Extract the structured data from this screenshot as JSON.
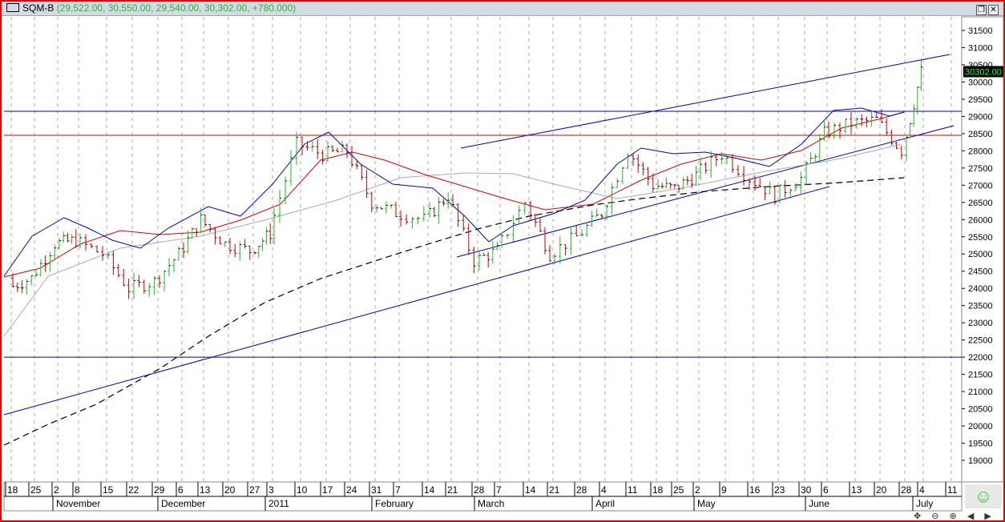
{
  "header": {
    "symbol": "SQM-B",
    "values": "(29,522.00, 30,550.00, 29,540.00, 30,302.00, +780.000)"
  },
  "chart_data": {
    "type": "ohlc",
    "title": "SQM-B",
    "last_price_label": "30302.00",
    "ylim": [
      18500,
      31800
    ],
    "y_ticks": [
      31500,
      31000,
      30500,
      30000,
      29500,
      29000,
      28500,
      28000,
      27500,
      27000,
      26500,
      26000,
      25500,
      25000,
      24500,
      24000,
      23500,
      23000,
      22500,
      22000,
      21500,
      21000,
      20500,
      20000,
      19500,
      19000
    ],
    "x_day_labels": [
      "18",
      "25",
      "2",
      "8",
      "15",
      "22",
      "29",
      "6",
      "13",
      "20",
      "27",
      "3",
      "10",
      "17",
      "24",
      "31",
      "7",
      "14",
      "21",
      "28",
      "7",
      "14",
      "21",
      "28",
      "4",
      "11",
      "18",
      "25",
      "2",
      "9",
      "16",
      "23",
      "30",
      "6",
      "13",
      "20",
      "28",
      "4",
      "11"
    ],
    "x_month_labels": [
      "November",
      "December",
      "2011",
      "February",
      "March",
      "April",
      "May",
      "June",
      "July"
    ],
    "weekly_closes": [
      24300,
      25300,
      25400,
      25000,
      24000,
      24200,
      25000,
      26000,
      25300,
      25100,
      25600,
      28200,
      27900,
      28000,
      26500,
      26200,
      26000,
      26700,
      24800,
      25100,
      26500,
      25000,
      25500,
      26200,
      28000,
      27000,
      26900,
      27300,
      27900,
      27200,
      26700,
      27200,
      28500,
      28800,
      28900,
      28000,
      30302
    ],
    "horizontal_lines": [
      {
        "price": 29150,
        "color": "#0000c0"
      },
      {
        "price": 28450,
        "color": "#d00000"
      },
      {
        "price": 22000,
        "color": "#0000c0"
      }
    ],
    "colors": {
      "up": "#22bb22",
      "down": "#cc0000",
      "ma_short": "#0000cc",
      "ma_mid": "#dd0000",
      "ma_long": "#aaaaaa",
      "ma_200": "#000000"
    }
  },
  "footer": {
    "smiley": "☺",
    "nav": "✥ ⊖ ⊕ ◀ ▶"
  }
}
